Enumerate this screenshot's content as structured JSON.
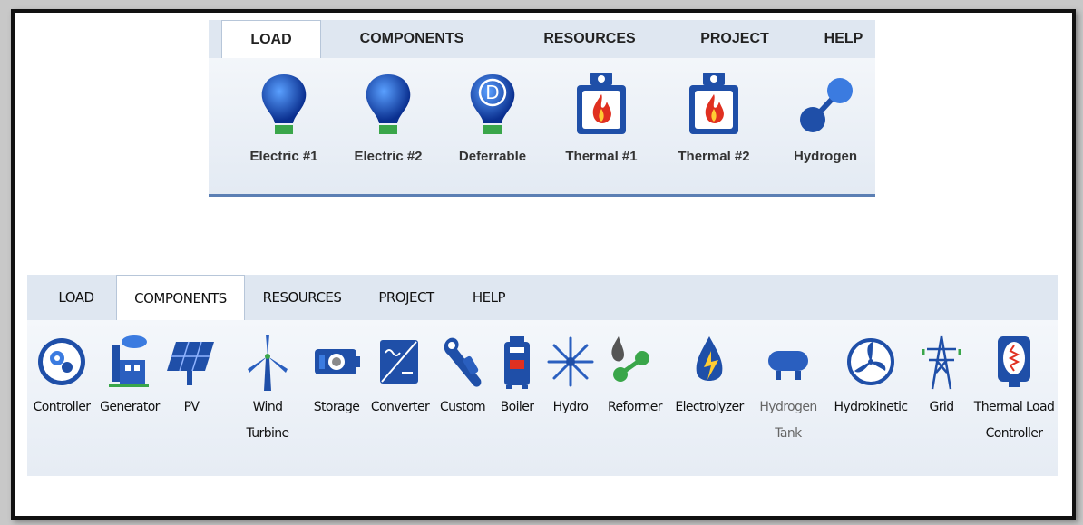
{
  "top_ribbon": {
    "tabs": [
      "LOAD",
      "COMPONENTS",
      "RESOURCES",
      "PROJECT",
      "HELP"
    ],
    "active_tab": "LOAD",
    "tools": [
      {
        "label": "Electric #1",
        "icon": "bulb-icon"
      },
      {
        "label": "Electric #2",
        "icon": "bulb-icon"
      },
      {
        "label": "Deferrable",
        "icon": "deferrable-bulb-icon",
        "badge": "D"
      },
      {
        "label": "Thermal #1",
        "icon": "thermal-flame-icon"
      },
      {
        "label": "Thermal #2",
        "icon": "thermal-flame-icon"
      },
      {
        "label": "Hydrogen",
        "icon": "hydrogen-molecule-icon"
      }
    ]
  },
  "bottom_ribbon": {
    "tabs": [
      "LOAD",
      "COMPONENTS",
      "RESOURCES",
      "PROJECT",
      "HELP"
    ],
    "active_tab": "COMPONENTS",
    "tools": [
      {
        "label": "Controller",
        "icon": "controller-gears-icon"
      },
      {
        "label": "Generator",
        "icon": "generator-factory-icon"
      },
      {
        "label": "PV",
        "icon": "pv-panel-icon"
      },
      {
        "label": "Wind\nTurbine",
        "icon": "wind-turbine-icon"
      },
      {
        "label": "Storage",
        "icon": "storage-battery-icon"
      },
      {
        "label": "Converter",
        "icon": "converter-icon"
      },
      {
        "label": "Custom",
        "icon": "custom-wrench-icon"
      },
      {
        "label": "Boiler",
        "icon": "boiler-icon"
      },
      {
        "label": "Hydro",
        "icon": "hydro-icon"
      },
      {
        "label": "Reformer",
        "icon": "reformer-icon"
      },
      {
        "label": "Electrolyzer",
        "icon": "electrolyzer-icon"
      },
      {
        "label": "Hydrogen\nTank",
        "icon": "hydrogen-tank-icon",
        "disabled": true
      },
      {
        "label": "Hydrokinetic",
        "icon": "hydrokinetic-icon"
      },
      {
        "label": "Grid",
        "icon": "grid-tower-icon"
      },
      {
        "label": "Thermal Load\nController",
        "icon": "thermal-load-controller-icon"
      }
    ]
  },
  "colors": {
    "tab_bg": "#dfe7f1",
    "accent": "#1f4fa8",
    "flame_red": "#e03020",
    "leaf_green": "#3aa64a"
  }
}
